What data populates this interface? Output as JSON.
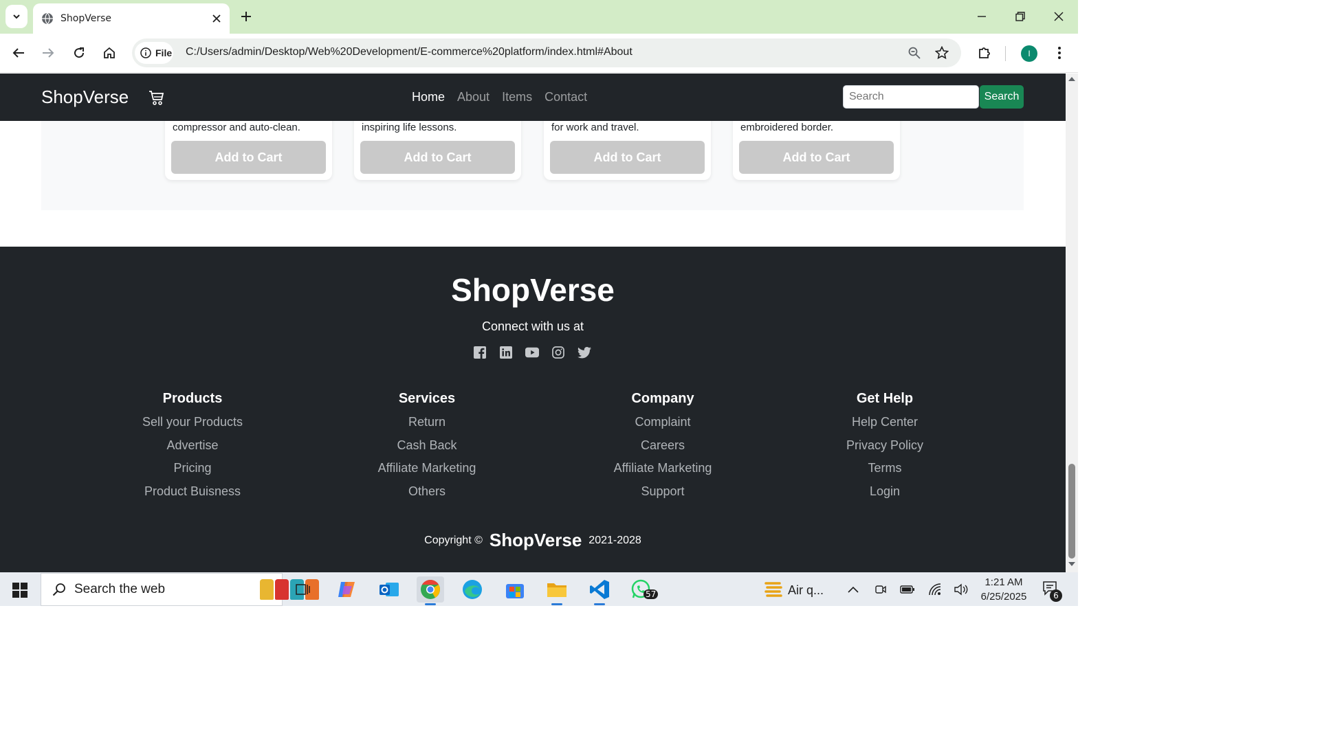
{
  "browser": {
    "tab_title": "ShopVerse",
    "url_chip_label": "File",
    "url": "C:/Users/admin/Desktop/Web%20Development/E-commerce%20platform/index.html#About",
    "profile_initial": "I"
  },
  "navbar": {
    "brand": "ShopVerse",
    "links": [
      "Home",
      "About",
      "Items",
      "Contact"
    ],
    "active_link": "Home",
    "search_placeholder": "Search",
    "search_button": "Search"
  },
  "products": [
    {
      "description_tail": "compressor and auto-clean.",
      "button": "Add to Cart"
    },
    {
      "description_tail": "inspiring life lessons.",
      "button": "Add to Cart"
    },
    {
      "description_tail": "for work and travel.",
      "button": "Add to Cart"
    },
    {
      "description_tail": "embroidered border.",
      "button": "Add to Cart"
    }
  ],
  "footer": {
    "brand": "ShopVerse",
    "connect_text": "Connect with us at",
    "socials": [
      "facebook-icon",
      "linkedin-icon",
      "youtube-icon",
      "instagram-icon",
      "twitter-icon"
    ],
    "columns": [
      {
        "title": "Products",
        "links": [
          "Sell your Products",
          "Advertise",
          "Pricing",
          "Product Buisness"
        ]
      },
      {
        "title": "Services",
        "links": [
          "Return",
          "Cash Back",
          "Affiliate Marketing",
          "Others"
        ]
      },
      {
        "title": "Company",
        "links": [
          "Complaint",
          "Careers",
          "Affiliate Marketing",
          "Support"
        ]
      },
      {
        "title": "Get Help",
        "links": [
          "Help Center",
          "Privacy Policy",
          "Terms",
          "Login"
        ]
      }
    ],
    "copyright_prefix": "Copyright ©",
    "copyright_brand": "ShopVerse",
    "copyright_years": "2021-2028"
  },
  "taskbar": {
    "search_text": "Search the web",
    "whatsapp_badge": "57",
    "weather_text": "Air q...",
    "time": "1:21 AM",
    "date": "6/25/2025",
    "notification_count": "6"
  },
  "colors": {
    "navbar_bg": "#212529",
    "search_button_bg": "#198754",
    "add_to_cart_bg": "#c9c9c9",
    "tabbar_bg": "#d3ecc7"
  }
}
